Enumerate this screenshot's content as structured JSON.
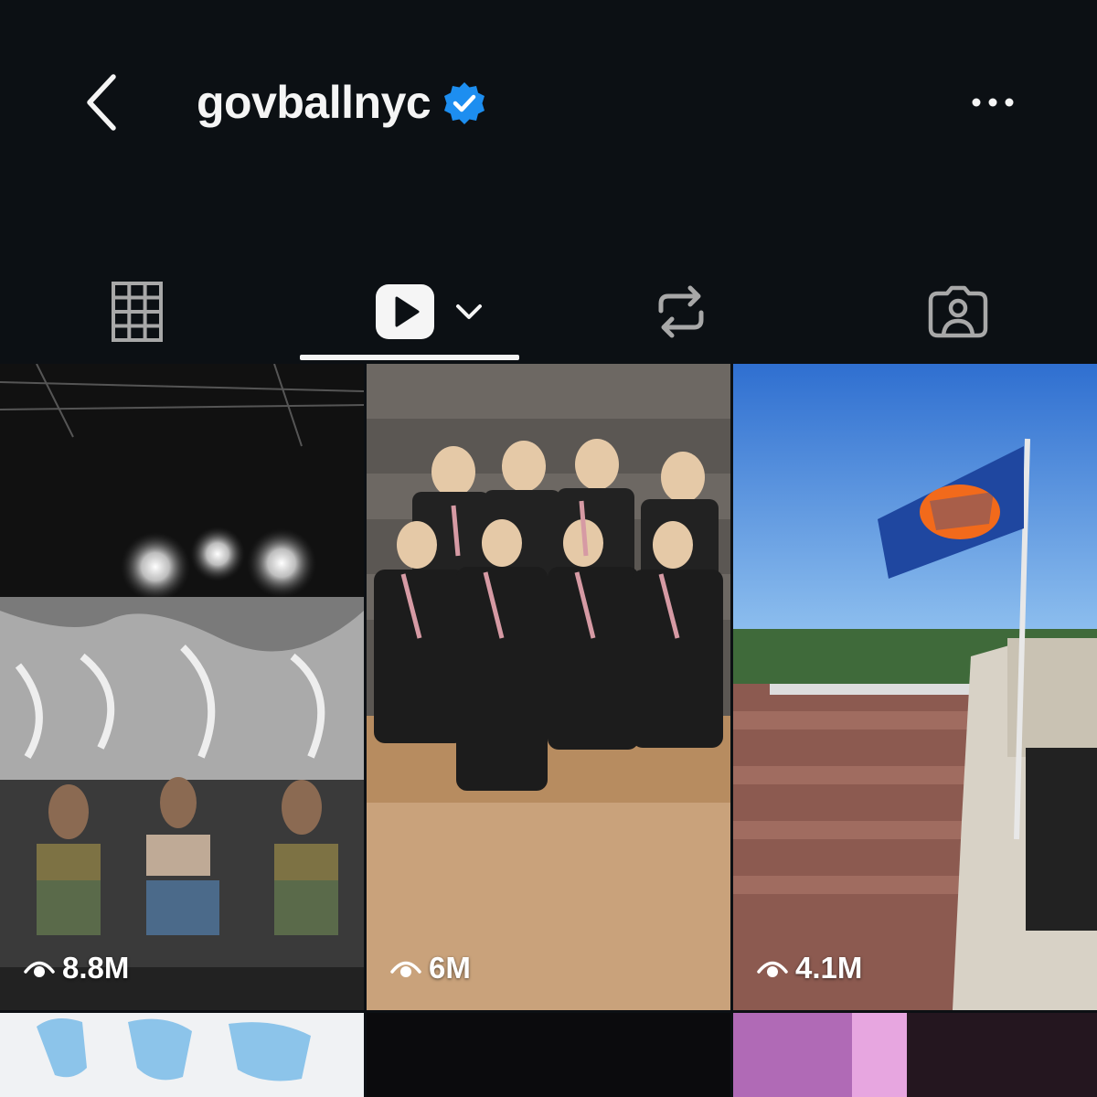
{
  "header": {
    "username": "govballnyc",
    "back_icon": "chevron-left-icon",
    "verified_icon": "verified-badge-icon",
    "more_icon": "more-horizontal-icon"
  },
  "tabs": [
    {
      "id": "posts",
      "icon": "grid-icon",
      "active": false
    },
    {
      "id": "reels",
      "icon": "play-icon",
      "active": true,
      "has_dropdown": true
    },
    {
      "id": "reposts",
      "icon": "repost-icon",
      "active": false
    },
    {
      "id": "tagged",
      "icon": "tagged-person-icon",
      "active": false
    }
  ],
  "reels": [
    {
      "views": "8.8M",
      "view_icon": "eye-icon"
    },
    {
      "views": "6M",
      "view_icon": "eye-icon"
    },
    {
      "views": "4.1M",
      "view_icon": "eye-icon"
    }
  ],
  "colors": {
    "background": "#0c1014",
    "text": "#f5f5f5",
    "verified": "#1d8ef0"
  }
}
